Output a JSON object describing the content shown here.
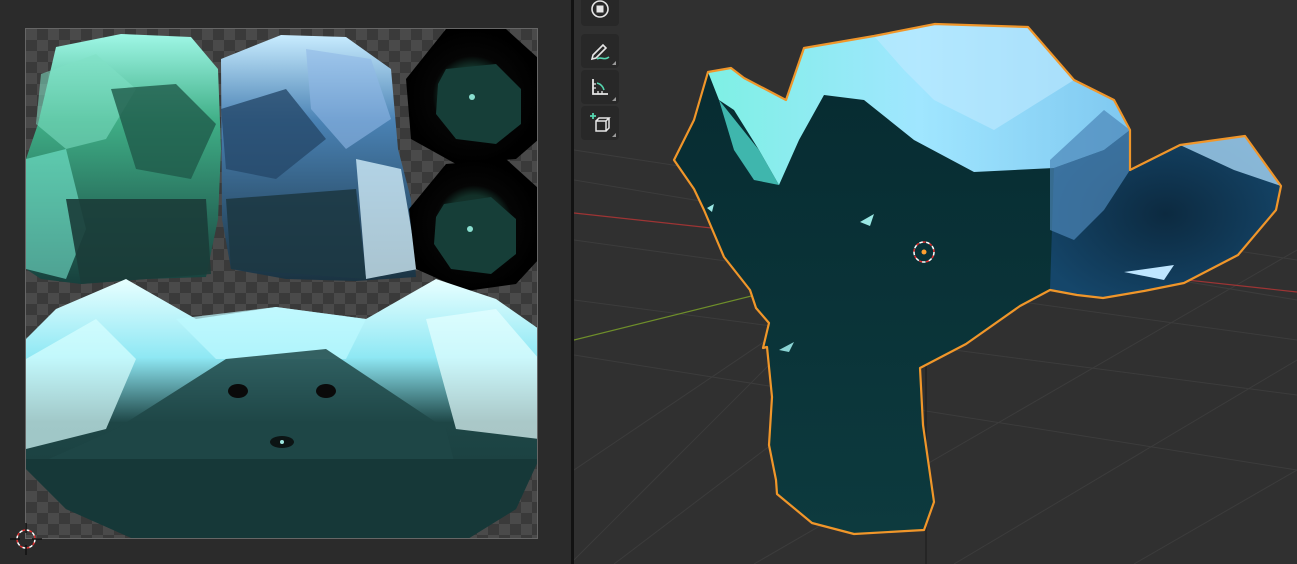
{
  "colors": {
    "editor_bg": "#2b2b2b",
    "viewport_bg": "#303030",
    "selection_outline": "#f0962a",
    "axis_x": "#b03a3a",
    "axis_y": "#6a8a2a",
    "mesh_top": "#a8ecff",
    "mesh_dark": "#0a2a32"
  },
  "image_editor": {
    "uv_islands": [
      "head-left-green",
      "head-right-blue",
      "ear-top",
      "ear-bottom",
      "face-front"
    ]
  },
  "viewport": {
    "toolbar": {
      "tools": [
        {
          "icon": "transform-icon"
        },
        {
          "icon": "annotate-icon"
        },
        {
          "icon": "measure-icon"
        },
        {
          "icon": "add-cube-icon"
        }
      ]
    },
    "object": {
      "icon": "origin-icon"
    }
  }
}
